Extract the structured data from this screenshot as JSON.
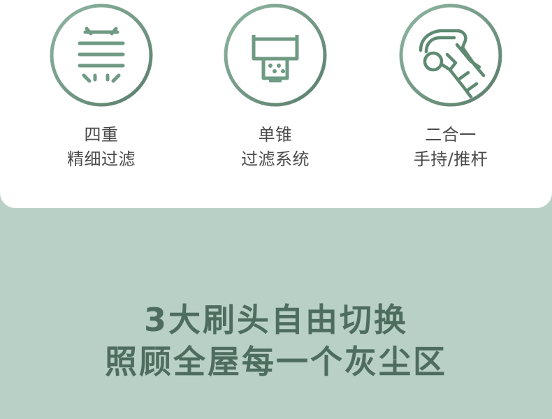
{
  "features": [
    {
      "icon": "four-layer-filter-icon",
      "line1": "四重",
      "line2": "精细过滤"
    },
    {
      "icon": "single-cone-filter-icon",
      "line1": "单锥",
      "line2": "过滤系统"
    },
    {
      "icon": "handheld-vacuum-icon",
      "line1": "二合一",
      "line2": "手持/推杆"
    }
  ],
  "headline": {
    "line1": "3大刷头自由切换",
    "line2": "照顾全屋每一个灰尘区"
  },
  "colors": {
    "background": "#b9d0c6",
    "card": "#ffffff",
    "icon_green": "#5e8a72",
    "headline": "#4e6d5f",
    "label": "#4a4a4a"
  }
}
